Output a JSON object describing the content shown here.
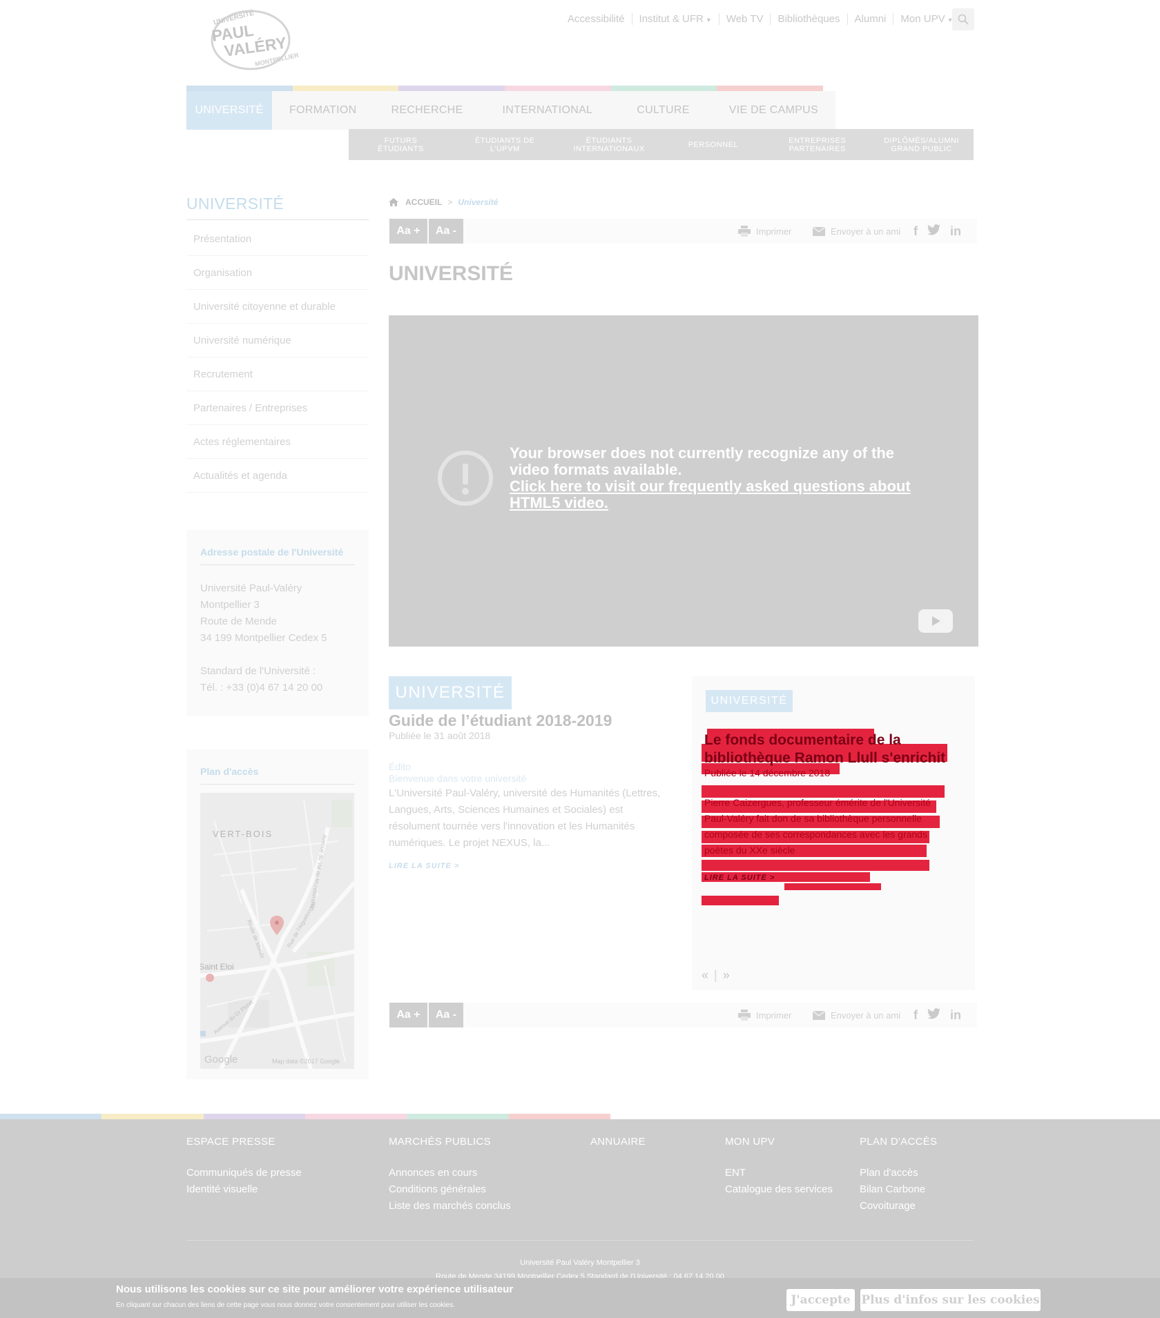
{
  "header": {
    "logo": {
      "top": "UNIVERSITÉ",
      "main1": "PAUL",
      "main2": "VALÉRY",
      "sub": "MONTPELLIER 3"
    },
    "topnav": [
      {
        "label": "Accessibilité",
        "dropdown": false
      },
      {
        "label": "Institut & UFR",
        "dropdown": true
      },
      {
        "label": "Web TV",
        "dropdown": false
      },
      {
        "label": "Bibliothèques",
        "dropdown": false
      },
      {
        "label": "Alumni",
        "dropdown": false
      },
      {
        "label": "Mon UPV",
        "dropdown": true
      }
    ],
    "search_icon": "search-icon"
  },
  "colors": {
    "accent": "#d6e7f4",
    "bar": [
      "#cfe0ee",
      "#f7ecc6",
      "#ddd6eb",
      "#f7d7e2",
      "#cfeadf",
      "#f6cfcf"
    ],
    "red_overlay": "#e4243f"
  },
  "mainnav": [
    {
      "label": "UNIVERSITÉ",
      "active": true
    },
    {
      "label": "FORMATION",
      "active": false
    },
    {
      "label": "RECHERCHE",
      "active": false
    },
    {
      "label": "INTERNATIONAL",
      "active": false
    },
    {
      "label": "CULTURE",
      "active": false
    },
    {
      "label": "VIE DE CAMPUS",
      "active": false
    }
  ],
  "subnav": [
    {
      "l1": "FUTURS",
      "l2": "ÉTUDIANTS"
    },
    {
      "l1": "ÉTUDIANTS DE",
      "l2": "L'UPVM"
    },
    {
      "l1": "ÉTUDIANTS",
      "l2": "INTERNATIONAUX"
    },
    {
      "l1": "PERSONNEL",
      "l2": ""
    },
    {
      "l1": "ENTREPRISES",
      "l2": "PARTENAIRES"
    },
    {
      "l1": "DIPLÔMÉS/ALUMNI",
      "l2": "GRAND PUBLIC"
    }
  ],
  "sidebar": {
    "title": "UNIVERSITÉ",
    "items": [
      "Présentation",
      "Organisation",
      "Université citoyenne et durable",
      "Université numérique",
      "Recrutement",
      "Partenaires / Entreprises",
      "Actes réglementaires",
      "Actualités et agenda"
    ],
    "address": {
      "title": "Adresse postale de l'Université",
      "lines": [
        "Université Paul-Valéry",
        "Montpellier 3",
        "Route de Mende",
        "34 199 Montpellier Cedex 5",
        "",
        "Standard de l'Université :",
        "Tél. : +33 (0)4 67 14 20 00"
      ]
    },
    "map": {
      "title": "Plan d'accès",
      "labels": {
        "vert_bois": "VERT-BOIS",
        "saint_eloi": "Saint Eloi",
        "road1": "Avenue du Val de Montferrand",
        "road2": "Route de Mende",
        "road3": "Rue de l'Aiguelongue",
        "road4": "Avenue du Dr Pezet",
        "google": "Google",
        "copyright": "Map data ©2017 Google"
      }
    }
  },
  "breadcrumb": {
    "home": "ACCUEIL",
    "sep": ">",
    "current": "Université"
  },
  "toolbar": {
    "font_plus": "Aa +",
    "font_minus": "Aa -",
    "print": "Imprimer",
    "send": "Envoyer à un ami",
    "social": [
      "f",
      "twitter",
      "in"
    ]
  },
  "page_title": "UNIVERSITÉ",
  "video": {
    "message": "Your browser does not currently recognize any of the video formats available.",
    "link": "Click here to visit our frequently asked questions about HTML5 video."
  },
  "article1": {
    "tag": "UNIVERSITÉ",
    "title": "Guide de l’étudiant 2018-2019",
    "date": "Publiée le 31 août 2018",
    "kicker1": "Édito",
    "kicker2": "Bienvenue dans votre université",
    "body": "L'Université Paul-Valéry, université des Humanités (Lettres, Langues, Arts, Sciences Humaines et Sociales) est résolument tournée vers l'innovation et les Humanités numériques. Le projet NEXUS, la...",
    "more": "LIRE LA SUITE  >"
  },
  "article2": {
    "tag": "UNIVERSITÉ",
    "title": "Le fonds documentaire de la bibliothèque Ramon Llull s'enrichit",
    "date": "Publiée le 14 décembre 2018",
    "body": "Pierre Caizergues, professeur émérite de l'Université Paul-Valéry fait don de sa bibliothèque personnelle composée de ses correspondances avec les grands poètes du XXe siècle",
    "more": "LIRE LA SUITE  >",
    "prev": "«",
    "next": "»"
  },
  "footer": {
    "columns": [
      {
        "title": "ESPACE PRESSE",
        "links": [
          "Communiqués de presse",
          "Identité visuelle"
        ]
      },
      {
        "title": "MARCHÉS PUBLICS",
        "links": [
          "Annonces en cours",
          "Conditions générales",
          "Liste des marchés conclus"
        ]
      },
      {
        "title": "ANNUAIRE",
        "links": []
      },
      {
        "title": "MON UPV",
        "links": [
          "ENT",
          "Catalogue des services"
        ]
      },
      {
        "title": "PLAN D'ACCÈS",
        "links": [
          "Plan d'accès",
          "Bilan Carbone",
          "Covoiturage"
        ]
      }
    ],
    "address1": "Université Paul Valéry Montpellier 3",
    "address2": "Route de Mende 34199 Montpellier Cedex 5 Standard de l'Université : 04 67 14 20 00"
  },
  "cookie": {
    "title": "Nous utilisons les cookies sur ce site pour améliorer votre expérience utilisateur",
    "sub": "En cliquant sur chacun des liens de cette page vous nous donnez votre consentement pour utiliser les cookies.",
    "accept": "J'accepte",
    "more": "Plus d'infos sur les cookies"
  }
}
